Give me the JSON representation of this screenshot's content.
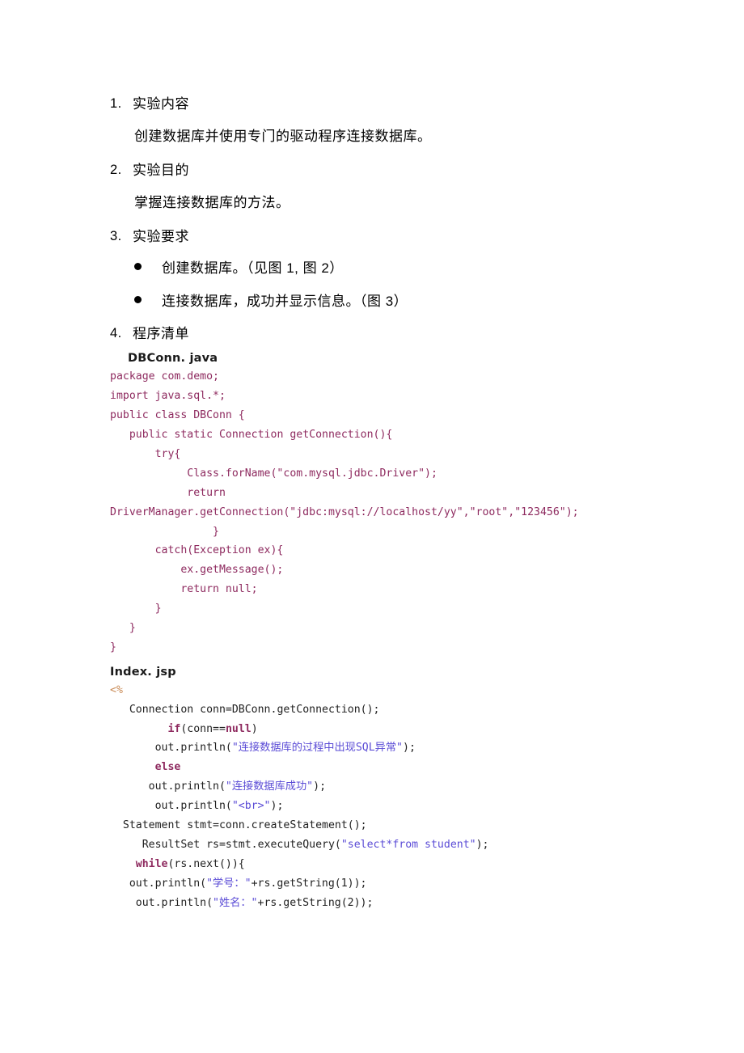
{
  "document": {
    "sections": [
      {
        "marker": "1.",
        "title": "实验内容",
        "body": "创建数据库并使用专门的驱动程序连接数据库。"
      },
      {
        "marker": "2.",
        "title": "实验目的",
        "body": "掌握连接数据库的方法。"
      },
      {
        "marker": "3.",
        "title": "实验要求",
        "body": ""
      },
      {
        "marker": "4.",
        "title": "程序清单",
        "body": ""
      }
    ],
    "requirements": [
      "创建数据库。（见图 1, 图 2）",
      "连接数据库，成功并显示信息。（图 3）"
    ],
    "listings": [
      {
        "filename": "DBConn. java",
        "language": "java",
        "lines": [
          "package com.demo;",
          "import java.sql.*;",
          "public class DBConn {",
          "   public static Connection getConnection(){",
          "       try{",
          "            Class.forName(\"com.mysql.jdbc.Driver\");",
          "            return",
          "DriverManager.getConnection(\"jdbc:mysql://localhost/yy\",\"root\",\"123456\");",
          "                }",
          "       catch(Exception ex){",
          "           ex.getMessage();",
          "           return null;",
          "       }",
          "   }",
          "}"
        ]
      },
      {
        "filename": "Index. jsp",
        "language": "jsp",
        "lines": [
          [
            {
              "t": "<%",
              "c": "tagp"
            }
          ],
          [
            {
              "t": "   Connection conn=DBConn.getConnection();",
              "c": ""
            }
          ],
          [
            {
              "t": "         ",
              "c": ""
            },
            {
              "t": "if",
              "c": "kw"
            },
            {
              "t": "(conn==",
              "c": ""
            },
            {
              "t": "null",
              "c": "kw"
            },
            {
              "t": ")",
              "c": ""
            }
          ],
          [
            {
              "t": "       out.println(",
              "c": ""
            },
            {
              "t": "\"连接数据库的过程中出现SQL异常\"",
              "c": "str"
            },
            {
              "t": ");",
              "c": ""
            }
          ],
          [
            {
              "t": "       ",
              "c": ""
            },
            {
              "t": "else",
              "c": "kw"
            }
          ],
          [
            {
              "t": "      out.println(",
              "c": ""
            },
            {
              "t": "\"连接数据库成功\"",
              "c": "str"
            },
            {
              "t": ");",
              "c": ""
            }
          ],
          [
            {
              "t": "       out.println(",
              "c": ""
            },
            {
              "t": "\"<br>\"",
              "c": "str"
            },
            {
              "t": ");",
              "c": ""
            }
          ],
          [
            {
              "t": "  Statement stmt=conn.createStatement();",
              "c": ""
            }
          ],
          [
            {
              "t": "     ResultSet rs=stmt.executeQuery(",
              "c": ""
            },
            {
              "t": "\"select*from student\"",
              "c": "str"
            },
            {
              "t": ");",
              "c": ""
            }
          ],
          [
            {
              "t": "    ",
              "c": ""
            },
            {
              "t": "while",
              "c": "kw"
            },
            {
              "t": "(rs.next()){",
              "c": ""
            }
          ],
          [
            {
              "t": "   out.println(",
              "c": ""
            },
            {
              "t": "\"学号：\"",
              "c": "str"
            },
            {
              "t": "+rs.getString(1));",
              "c": ""
            }
          ],
          [
            {
              "t": "    out.println(",
              "c": ""
            },
            {
              "t": "\"姓名：\"",
              "c": "str"
            },
            {
              "t": "+rs.getString(2));",
              "c": ""
            }
          ]
        ]
      }
    ]
  },
  "colors": {
    "java_code": "#8e2a5f",
    "jsp_keyword": "#8e2a5f",
    "jsp_string": "#5b4cd6",
    "jsp_tag": "#c98a55",
    "body_text": "#000000"
  }
}
